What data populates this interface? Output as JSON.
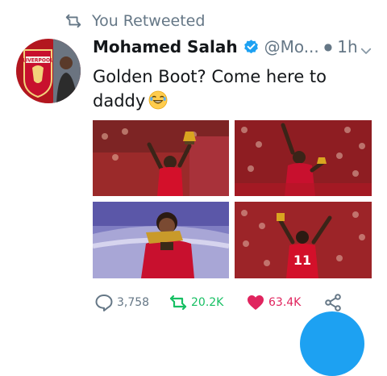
{
  "retweet": {
    "label": "You Retweeted"
  },
  "tweet": {
    "author_name": "Mohamed Salah",
    "handle": "@Mo...",
    "time": "1h",
    "text": "Golden Boot? Come here to daddy",
    "emoji": "laughing-face"
  },
  "avatar": {
    "badge_text": "LIVERPOOL"
  },
  "media": {
    "images": [
      {
        "subject": "player celebrating with golden boot trophy in stadium"
      },
      {
        "subject": "player waving to crowd with trophy"
      },
      {
        "subject": "player holding golden boot trophy"
      },
      {
        "subject": "player number 11 celebrating on pitch",
        "shirt_number": "11"
      }
    ]
  },
  "actions": {
    "replies": "3,758",
    "retweets": "20.2K",
    "likes": "63.4K"
  },
  "colors": {
    "verified": "#1da1f2",
    "retweet": "#17bf63",
    "like": "#e0245e",
    "gray": "#657786",
    "liverpool_red": "#c8102e"
  }
}
